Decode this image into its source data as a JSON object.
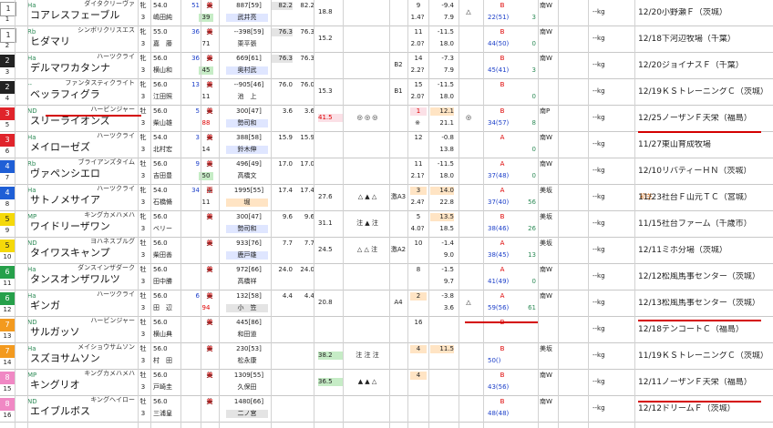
{
  "entries": [
    {
      "gate": "1",
      "num": "1",
      "sire": "ダイタクリーヴァ",
      "mark": "Ha",
      "name": "コアレスフェーブル",
      "sex": "牝",
      "age": "3",
      "wt": "54.0",
      "jockey": "嶋田純",
      "jw": "51",
      "rank": "39",
      "area": "東",
      "cls": "美",
      "trainer_r": "887[59]",
      "trainer": "武井亮",
      "t1": "82.2",
      "t2": "82.2",
      "sc": "18.8",
      "marks": "",
      "t3": "",
      "pop": "9",
      "odds": "1.4?",
      "dev": "-9.4",
      "vv": "7.9",
      "tri": "△",
      "ev": "B",
      "evs": "22(51)",
      "evn": "3",
      "farm": "南W",
      "kg": "--kg",
      "note": "",
      "info": "12/20小野瀬Ｆ（茨城）"
    },
    {
      "gate": "1",
      "num": "2",
      "sire": "シンボリクリスエス",
      "mark": "Rb",
      "name": "ヒダマリ",
      "sex": "牝",
      "age": "3",
      "wt": "55.0",
      "jockey": "嘉　藤",
      "jw": "36",
      "rank": "71",
      "area": "東",
      "cls": "美",
      "trainer_r": "--398[59]",
      "trainer": "栗平張",
      "t1": "76.3",
      "t2": "76.3",
      "sc": "15.2",
      "marks": "",
      "t3": "",
      "pop": "11",
      "odds": "2.0?",
      "dev": "-11.5",
      "vv": "18.0",
      "tri": "",
      "ev": "B",
      "evs": "44(50)",
      "evn": "0",
      "farm": "南W",
      "kg": "--kg",
      "note": "",
      "info": "12/18下河辺牧場（千葉）"
    },
    {
      "gate": "2",
      "num": "3",
      "sire": "ハーツクライ",
      "mark": "Ha",
      "name": "デルマワカタンナ",
      "sex": "牝",
      "age": "3",
      "wt": "56.0",
      "jockey": "横山和",
      "jw": "36",
      "rank": "45",
      "area": "東",
      "cls": "美",
      "trainer_r": "669[61]",
      "trainer": "奥村武",
      "t1": "76.3",
      "t2": "76.3",
      "sc": "",
      "marks": "",
      "t3": "B2",
      "pop": "14",
      "odds": "2.2?",
      "dev": "-7.3",
      "vv": "7.9",
      "tri": "",
      "ev": "B",
      "evs": "45(41)",
      "evn": "3",
      "farm": "南W",
      "kg": "--kg",
      "note": "",
      "info": "12/20ジョイナスＦ（千葉）"
    },
    {
      "gate": "2",
      "num": "4",
      "sire": "ファンタスティクライト",
      "mark": "--",
      "name": "ベッラフィグラ",
      "sex": "牝",
      "age": "3",
      "wt": "56.0",
      "jockey": "江田照",
      "jw": "13",
      "rank": "11",
      "area": "東",
      "cls": "美",
      "trainer_r": "--905[46]",
      "trainer": "池　上",
      "t1": "76.0",
      "t2": "76.0",
      "sc": "15.3",
      "marks": "",
      "t3": "B1",
      "pop": "15",
      "odds": "2.0?",
      "dev": "-11.5",
      "vv": "18.0",
      "tri": "",
      "ev": "B",
      "evs": "",
      "evn": "0",
      "farm": "",
      "kg": "--kg",
      "note": "",
      "info": "12/19ＫＳトレーニングＣ（茨城）"
    },
    {
      "gate": "3",
      "num": "5",
      "sire": "ハービンジャー",
      "mark": "ND",
      "name": "スリーライオンズ",
      "sex": "牡",
      "age": "3",
      "wt": "56.0",
      "jockey": "柴山雄",
      "jw": "5",
      "rank": "88",
      "area": "東",
      "cls": "美",
      "trainer_r": "300[47]",
      "trainer": "勢司和",
      "t1": "3.6",
      "t2": "3.6",
      "sc": "41.5",
      "marks": "◎ ◎ ◎",
      "t3": "",
      "pop": "1",
      "odds": "※",
      "dev": "12.1",
      "vv": "21.1",
      "tri": "◎",
      "ev": "B",
      "evs": "34(57)",
      "evn": "8",
      "farm": "南P",
      "kg": "--kg",
      "note": "",
      "info": "12/25ノーザンＦ天栄（福島）"
    },
    {
      "gate": "3",
      "num": "6",
      "sire": "ハーツクライ",
      "mark": "Ha",
      "name": "メイローゼズ",
      "sex": "牝",
      "age": "3",
      "wt": "54.0",
      "jockey": "北村宏",
      "jw": "3",
      "rank": "14",
      "area": "東",
      "cls": "美",
      "trainer_r": "388[58]",
      "trainer": "鈴木伸",
      "t1": "15.9",
      "t2": "15.9",
      "sc": "",
      "marks": "",
      "t3": "",
      "pop": "12",
      "odds": "",
      "dev": "-0.8",
      "vv": "13.8",
      "tri": "",
      "ev": "A",
      "evs": "",
      "evn": "0",
      "farm": "南W",
      "kg": "--kg",
      "note": "",
      "info": "11/27東山育成牧場"
    },
    {
      "gate": "4",
      "num": "7",
      "sire": "ブライアンズタイム",
      "mark": "Rb",
      "name": "ヴァペンシエロ",
      "sex": "牡",
      "age": "3",
      "wt": "56.0",
      "jockey": "吉田豊",
      "jw": "9",
      "rank": "50",
      "area": "東",
      "cls": "美",
      "trainer_r": "496[49]",
      "trainer": "高橋文",
      "t1": "17.0",
      "t2": "17.0",
      "sc": "",
      "marks": "",
      "t3": "",
      "pop": "11",
      "odds": "2.1?",
      "dev": "-11.5",
      "vv": "18.0",
      "tri": "",
      "ev": "A",
      "evs": "37(48)",
      "evn": "0",
      "farm": "南W",
      "kg": "--kg",
      "note": "",
      "info": "12/10リバティーＨＮ（茨城）"
    },
    {
      "gate": "4",
      "num": "8",
      "sire": "ハーツクライ",
      "mark": "Ha",
      "name": "サトノメサイア",
      "sex": "牝",
      "age": "3",
      "wt": "54.0",
      "jockey": "石橋脩",
      "jw": "34",
      "rank": "11",
      "area": "西",
      "cls": "栗",
      "trainer_r": "1995[55]",
      "trainer": "堀",
      "t1": "17.4",
      "t2": "17.4",
      "sc": "27.6",
      "marks": "△ ▲ △",
      "t3": "激A3",
      "pop": "3",
      "odds": "2.4?",
      "dev": "14.0",
      "vv": "22.8",
      "tri": "",
      "ev": "A",
      "evs": "37(40)",
      "evn": "56",
      "farm": "美坂",
      "kg": "--kg",
      "note": "初芝",
      "info": "11/23社台Ｆ山元ＴＣ（宮城）"
    },
    {
      "gate": "5",
      "num": "9",
      "sire": "キングカメハメハ",
      "mark": "MP",
      "name": "ワイドリーザワン",
      "sex": "牝",
      "age": "3",
      "wt": "56.0",
      "jockey": "ベリー",
      "jw": "",
      "rank": "",
      "area": "東",
      "cls": "美",
      "trainer_r": "300[47]",
      "trainer": "勢司和",
      "t1": "9.6",
      "t2": "9.6",
      "sc": "31.1",
      "marks": "注 ▲ 注",
      "t3": "",
      "pop": "5",
      "odds": "4.0?",
      "dev": "13.5",
      "vv": "18.5",
      "tri": "",
      "ev": "B",
      "evs": "38(46)",
      "evn": "26",
      "farm": "美坂",
      "kg": "--kg",
      "note": "",
      "info": "11/15社台ファーム（千歳市）"
    },
    {
      "gate": "5",
      "num": "10",
      "sire": "ヨハネスブルグ",
      "mark": "ND",
      "name": "タイワスキャンプ",
      "sex": "牡",
      "age": "3",
      "wt": "56.0",
      "jockey": "柴田善",
      "jw": "",
      "rank": "",
      "area": "東",
      "cls": "美",
      "trainer_r": "933[76]",
      "trainer": "鹿戸雄",
      "t1": "7.7",
      "t2": "7.7",
      "sc": "24.5",
      "marks": "△ △ 注",
      "t3": "激A2",
      "pop": "10",
      "odds": "",
      "dev": "-1.4",
      "vv": "9.0",
      "tri": "",
      "ev": "A",
      "evs": "38(45)",
      "evn": "13",
      "farm": "美坂",
      "kg": "--kg",
      "note": "",
      "info": "12/11ミホ分場（茨城）"
    },
    {
      "gate": "6",
      "num": "11",
      "sire": "ダンスインザダーク",
      "mark": "Ha",
      "name": "タンスオンザワルツ",
      "sex": "牡",
      "age": "3",
      "wt": "56.0",
      "jockey": "田中勝",
      "jw": "",
      "rank": "",
      "area": "東",
      "cls": "美",
      "trainer_r": "972[66]",
      "trainer": "高橋祥",
      "t1": "24.0",
      "t2": "24.0",
      "sc": "",
      "marks": "",
      "t3": "",
      "pop": "8",
      "odds": "",
      "dev": "-1.5",
      "vv": "9.7",
      "tri": "",
      "ev": "A",
      "evs": "41(49)",
      "evn": "0",
      "farm": "南W",
      "kg": "--kg",
      "note": "",
      "info": "12/12松風馬事センター（茨城）"
    },
    {
      "gate": "6",
      "num": "12",
      "sire": "ハーツクライ",
      "mark": "Ha",
      "name": "ギンガ",
      "sex": "牡",
      "age": "3",
      "wt": "56.0",
      "jockey": "田　辺",
      "jw": "6",
      "rank": "94",
      "area": "東",
      "cls": "美",
      "trainer_r": "132[58]",
      "trainer": "小　笠",
      "t1": "4.4",
      "t2": "4.4",
      "sc": "20.8",
      "marks": "",
      "t3": "A4",
      "pop": "2",
      "odds": "",
      "dev": "-3.8",
      "vv": "3.6",
      "tri": "△",
      "ev": "A",
      "evs": "59(56)",
      "evn": "61",
      "farm": "南W",
      "kg": "--kg",
      "note": "",
      "info": "12/13松風馬事センター（茨城）"
    },
    {
      "gate": "7",
      "num": "13",
      "sire": "ハービンジャー",
      "mark": "ND",
      "name": "サルガッソ",
      "sex": "牡",
      "age": "3",
      "wt": "56.0",
      "jockey": "横山典",
      "jw": "",
      "rank": "",
      "area": "東",
      "cls": "美",
      "trainer_r": "445[86]",
      "trainer": "和田道",
      "t1": "",
      "t2": "",
      "sc": "",
      "marks": "",
      "t3": "",
      "pop": "16",
      "odds": "",
      "dev": "",
      "vv": "",
      "tri": "",
      "ev": "B",
      "evs": "",
      "evn": "",
      "farm": "",
      "kg": "--kg",
      "note": "",
      "info": "12/18テンコートＣ（福島）"
    },
    {
      "gate": "7",
      "num": "14",
      "sire": "メイショウサムソン",
      "mark": "Ha",
      "name": "スズヨサムソン",
      "sex": "牡",
      "age": "3",
      "wt": "56.0",
      "jockey": "村　田",
      "jw": "",
      "rank": "",
      "area": "東",
      "cls": "美",
      "trainer_r": "230[53]",
      "trainer": "松永康",
      "t1": "",
      "t2": "",
      "sc": "38.2",
      "marks": "注 注 注",
      "t3": "",
      "pop": "4",
      "odds": "",
      "dev": "11.5",
      "vv": "",
      "tri": "",
      "ev": "B",
      "evs": "50()",
      "evn": "",
      "farm": "美坂",
      "kg": "--kg",
      "note": "",
      "info": "11/19ＫＳトレーニングＣ（茨城）"
    },
    {
      "gate": "8",
      "num": "15",
      "sire": "キングカメハメハ",
      "mark": "MP",
      "name": "キングリオ",
      "sex": "牡",
      "age": "3",
      "wt": "56.0",
      "jockey": "戸崎圭",
      "jw": "",
      "rank": "",
      "area": "東",
      "cls": "美",
      "trainer_r": "1309[55]",
      "trainer": "久保田",
      "t1": "",
      "t2": "",
      "sc": "36.5",
      "marks": "▲ ▲ △",
      "t3": "",
      "pop": "4",
      "odds": "",
      "dev": "",
      "vv": "",
      "tri": "",
      "ev": "B",
      "evs": "43(56)",
      "evn": "",
      "farm": "南W",
      "kg": "--kg",
      "note": "",
      "info": "12/11ノーザンＦ天栄（福島）"
    },
    {
      "gate": "8",
      "num": "16",
      "sire": "キングヘイロー",
      "mark": "ND",
      "name": "エイブルボス",
      "sex": "牡",
      "age": "3",
      "wt": "56.0",
      "jockey": "三浦皇",
      "jw": "",
      "rank": "",
      "area": "東",
      "cls": "美",
      "trainer_r": "1480[66]",
      "trainer": "二ノ宮",
      "t1": "",
      "t2": "",
      "sc": "",
      "marks": "",
      "t3": "",
      "pop": "",
      "odds": "",
      "dev": "",
      "vv": "",
      "tri": "",
      "ev": "B",
      "evs": "48(48)",
      "evn": "",
      "farm": "南W",
      "kg": "--kg",
      "note": "",
      "info": "12/12ドリームＦ（茨城）"
    }
  ],
  "colors": {
    "gate1": "#ffffff",
    "gate2": "#222222",
    "gate3": "#e0242b",
    "gate4": "#1f5fd6",
    "gate5": "#f5d90a",
    "gate6": "#26a04a",
    "gate7": "#f39a1f",
    "gate8": "#f088c4",
    "underline": "#d40000"
  }
}
